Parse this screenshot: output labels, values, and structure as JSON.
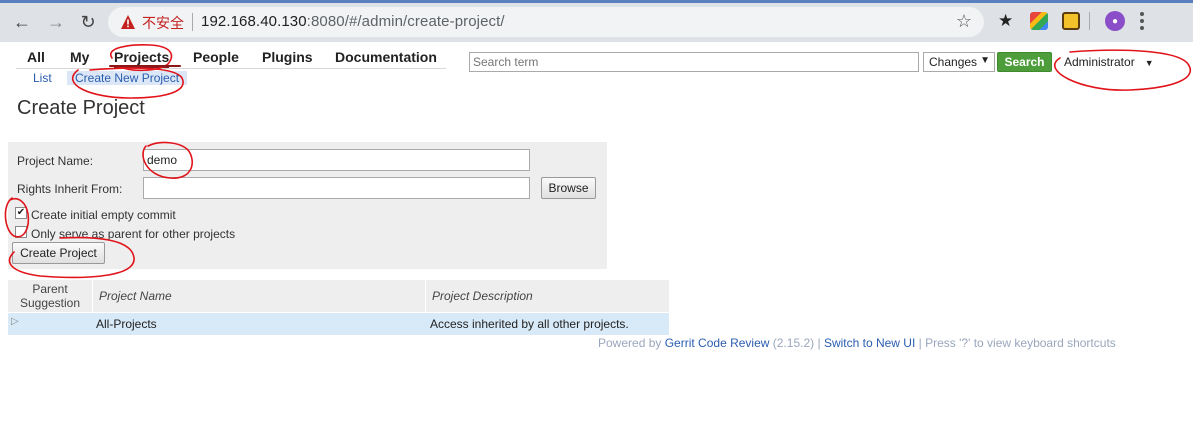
{
  "browser": {
    "security_label": "不安全",
    "url_host": "192.168.40.130",
    "url_rest": ":8080/#/admin/create-project/"
  },
  "topmenu": {
    "items": [
      "All",
      "My",
      "Projects",
      "People",
      "Plugins",
      "Documentation"
    ],
    "active": "Projects"
  },
  "submenu": {
    "list": "List",
    "create": "Create New Project"
  },
  "search": {
    "placeholder": "Search term",
    "scope": "Changes",
    "button": "Search"
  },
  "user": {
    "name": "Administrator"
  },
  "page": {
    "title": "Create Project"
  },
  "form": {
    "project_name_label": "Project Name:",
    "project_name_value": "demo",
    "rights_label": "Rights Inherit From:",
    "rights_value": "",
    "browse_button": "Browse",
    "initial_commit_label": "Create initial empty commit",
    "initial_commit_checked": true,
    "parent_only_label": "Only serve as parent for other projects",
    "parent_only_checked": false,
    "create_button": "Create Project"
  },
  "table": {
    "headers": [
      "Parent Suggestion",
      "Project Name",
      "Project Description"
    ],
    "rows": [
      {
        "name": "All-Projects",
        "description": "Access inherited by all other projects."
      }
    ]
  },
  "footer": {
    "powered_by": "Powered by",
    "product": "Gerrit Code Review",
    "version": "(2.15.2)",
    "sep1": "|",
    "switch_ui": "Switch to New UI",
    "sep2": "|",
    "shortcuts": "Press '?' to view keyboard shortcuts"
  }
}
